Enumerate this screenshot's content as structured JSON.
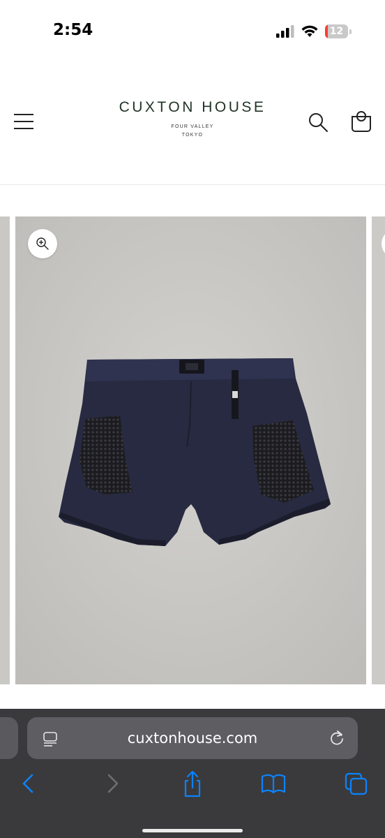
{
  "status_bar": {
    "time": "2:54",
    "battery_level": "12",
    "battery_fraction": 0.12,
    "icons": [
      "cellular-signal-icon",
      "wifi-icon",
      "battery-icon"
    ]
  },
  "header": {
    "brand_name": "CUXTON HOUSE",
    "brand_sub_line1": "FOUR VALLEY",
    "brand_sub_line2": "TOKYO",
    "icons": [
      "menu-icon",
      "search-icon",
      "shopping-bag-icon"
    ],
    "brand_color": "#1f3325"
  },
  "gallery": {
    "main_image": "navy nylon shorts with mesh side pockets on concrete background",
    "icons": [
      "zoom-in-icon"
    ]
  },
  "browser": {
    "url": "cuxtonhouse.com",
    "icons": [
      "reader-mode-icon",
      "reload-icon",
      "back-icon",
      "forward-icon",
      "share-icon",
      "bookmarks-icon",
      "tabs-icon"
    ],
    "accent_color": "#0a84ff"
  }
}
